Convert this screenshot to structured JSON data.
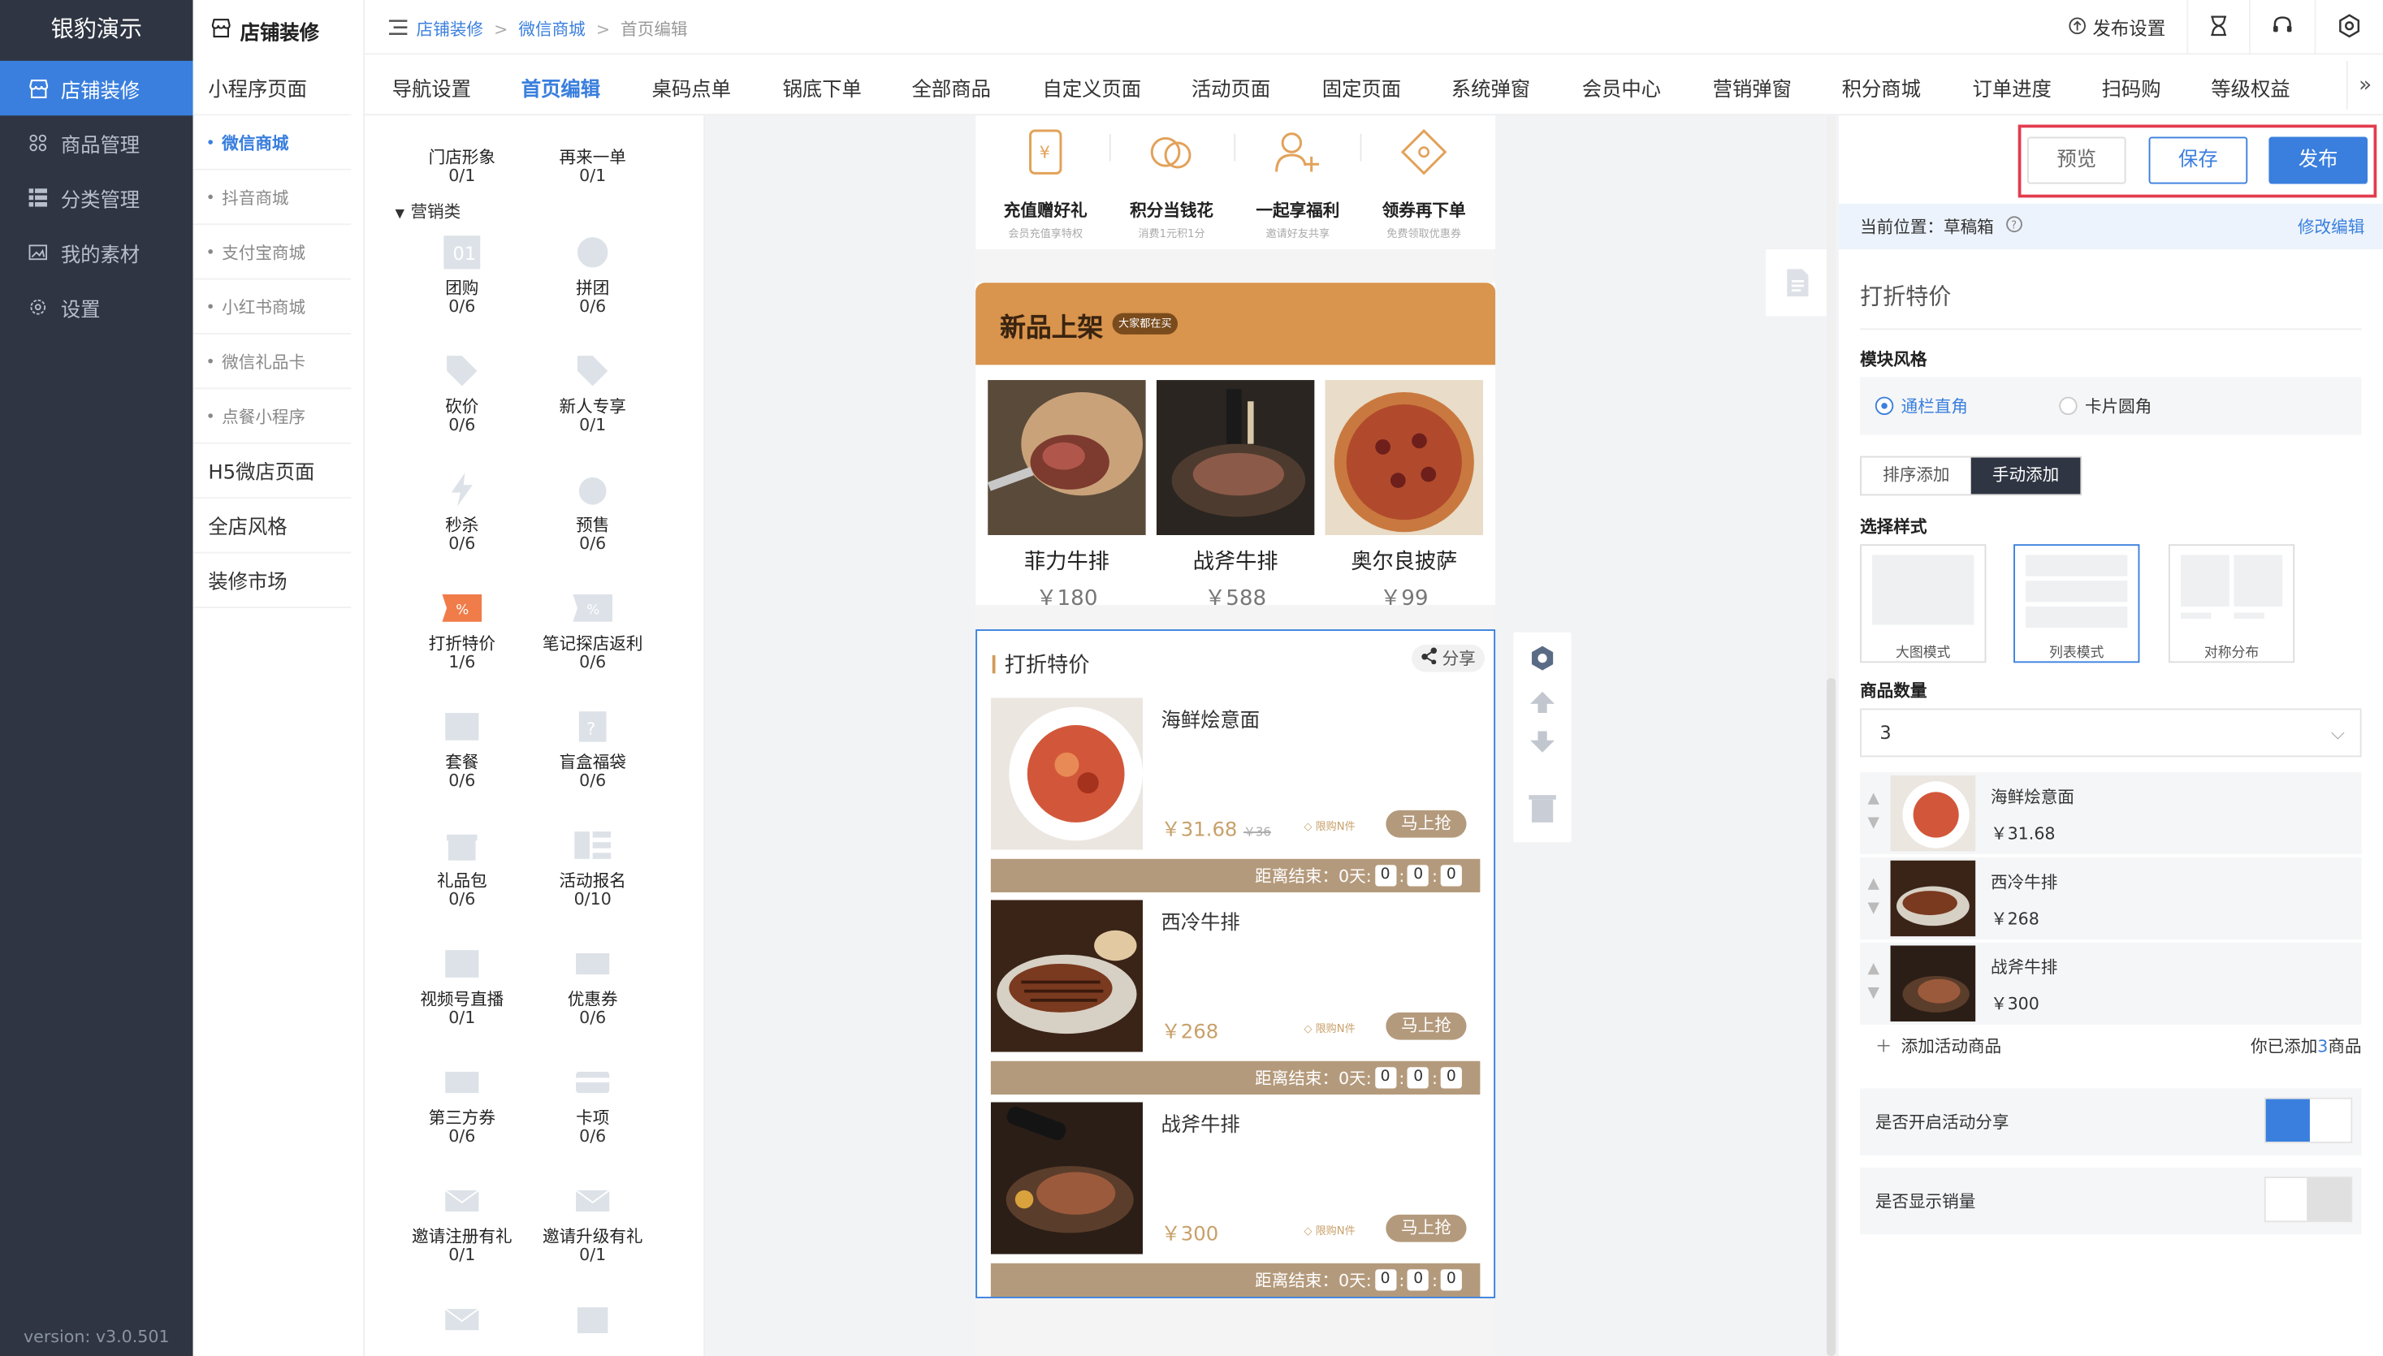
{
  "colors": {
    "accent": "#3a7fde",
    "nav_bg": "#2f3542",
    "highlight_box": "#e23c4e",
    "gold": "#d9944d"
  },
  "nav": {
    "brand": "银豹演示",
    "items": [
      {
        "label": "店铺装修",
        "icon": "shop-icon"
      },
      {
        "label": "商品管理",
        "icon": "goods-icon"
      },
      {
        "label": "分类管理",
        "icon": "category-icon"
      },
      {
        "label": "我的素材",
        "icon": "image-icon"
      },
      {
        "label": "设置",
        "icon": "gear-icon"
      }
    ],
    "version": "version: v3.0.501"
  },
  "subnav": {
    "title": "店铺装修",
    "groups": {
      "g1": "小程序页面",
      "s1": "微信商城",
      "s2": "抖音商城",
      "s3": "支付宝商城",
      "s4": "小红书商城",
      "s5": "微信礼品卡",
      "s6": "点餐小程序",
      "g2": "H5微店页面",
      "g3": "全店风格",
      "g4": "装修市场"
    }
  },
  "breadcrumb": {
    "a": "店铺装修",
    "b": "微信商城",
    "c": "首页编辑"
  },
  "topbar": {
    "publish_settings": "发布设置"
  },
  "tabs": [
    "导航设置",
    "首页编辑",
    "桌码点单",
    "锅底下单",
    "全部商品",
    "自定义页面",
    "活动页面",
    "固定页面",
    "系统弹窗",
    "会员中心",
    "营销弹窗",
    "积分商城",
    "订单进度",
    "扫码购",
    "等级权益"
  ],
  "components": {
    "category": "营销类",
    "items": [
      {
        "name": "门店形象",
        "count": "0/1"
      },
      {
        "name": "再来一单",
        "count": "0/1"
      },
      {
        "name": "团购",
        "count": "0/6"
      },
      {
        "name": "拼团",
        "count": "0/6"
      },
      {
        "name": "砍价",
        "count": "0/6"
      },
      {
        "name": "新人专享",
        "count": "0/1"
      },
      {
        "name": "秒杀",
        "count": "0/6"
      },
      {
        "name": "预售",
        "count": "0/6"
      },
      {
        "name": "打折特价",
        "count": "1/6"
      },
      {
        "name": "笔记探店返利",
        "count": "0/6"
      },
      {
        "name": "套餐",
        "count": "0/6"
      },
      {
        "name": "盲盒福袋",
        "count": "0/6"
      },
      {
        "name": "礼品包",
        "count": "0/6"
      },
      {
        "name": "活动报名",
        "count": "0/10"
      },
      {
        "name": "视频号直播",
        "count": "0/1"
      },
      {
        "name": "优惠券",
        "count": "0/6"
      },
      {
        "name": "第三方券",
        "count": "0/6"
      },
      {
        "name": "卡项",
        "count": "0/6"
      },
      {
        "name": "邀请注册有礼",
        "count": "0/1"
      },
      {
        "name": "邀请升级有礼",
        "count": "0/1"
      }
    ]
  },
  "phone": {
    "quick": [
      {
        "title": "充值赠好礼",
        "sub": "会员充值享特权"
      },
      {
        "title": "积分当钱花",
        "sub": "消费1元积1分"
      },
      {
        "title": "一起享福利",
        "sub": "邀请好友共享"
      },
      {
        "title": "领券再下单",
        "sub": "免费领取优惠券"
      }
    ],
    "new_arrival": {
      "title": "新品上架",
      "tag": "大家都在买",
      "items": [
        {
          "name": "菲力牛排",
          "price": "￥180"
        },
        {
          "name": "战斧牛排",
          "price": "￥588"
        },
        {
          "name": "奥尔良披萨",
          "price": "￥99"
        }
      ]
    },
    "discount": {
      "title": "打折特价",
      "share": "分享",
      "limit": "限购N件",
      "buy": "马上抢",
      "countdown_label": "距离结束：",
      "days": "0天:",
      "d0": "0",
      "d1": "0",
      "d2": "0",
      "items": [
        {
          "name": "海鲜烩意面",
          "price": "￥31.68",
          "orig": "￥36"
        },
        {
          "name": "西冷牛排",
          "price": "￥268",
          "orig": ""
        },
        {
          "name": "战斧牛排",
          "price": "￥300",
          "orig": ""
        }
      ]
    }
  },
  "right": {
    "preview": "预览",
    "save": "保存",
    "publish": "发布",
    "location": "当前位置：草稿箱",
    "edit": "修改编辑",
    "title": "打折特价",
    "style_label": "模块风格",
    "style_opt1": "通栏直角",
    "style_opt2": "卡片圆角",
    "add_sort": "排序添加",
    "add_manual": "手动添加",
    "select_style": "选择样式",
    "styles": [
      "大图模式",
      "列表模式",
      "对称分布"
    ],
    "qty_label": "商品数量",
    "qty": "3",
    "goods": [
      {
        "name": "海鲜烩意面",
        "price": "￥31.68"
      },
      {
        "name": "西冷牛排",
        "price": "￥268"
      },
      {
        "name": "战斧牛排",
        "price": "￥300"
      }
    ],
    "add_goods": "添加活动商品",
    "added_pre": "你已添加",
    "added_n": "3",
    "added_post": "商品",
    "share_toggle": "是否开启活动分享",
    "sales_toggle": "是否显示销量"
  }
}
